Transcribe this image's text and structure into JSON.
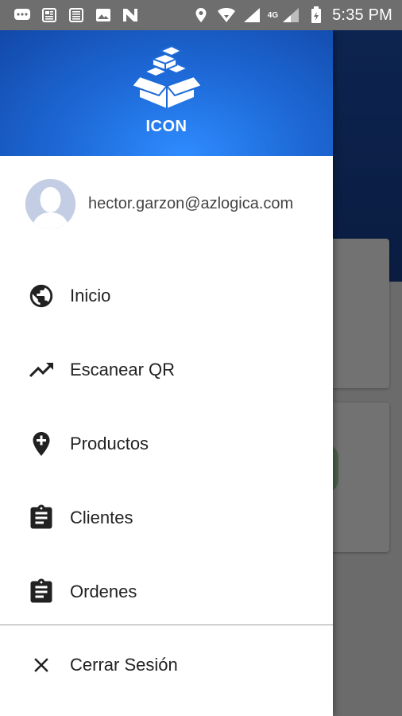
{
  "status_bar": {
    "network": "4G",
    "time": "5:35 PM",
    "left_icons": [
      "messages-icon",
      "news-icon",
      "news-icon",
      "image-icon",
      "n-app-icon"
    ],
    "right_icons": [
      "location-icon",
      "wifi-icon",
      "signal-icon",
      "signal-icon",
      "battery-icon"
    ]
  },
  "drawer": {
    "header": {
      "app_name": "ICON",
      "logo_icon": "boxes-logo-icon"
    },
    "profile": {
      "email": "hector.garzon@azlogica.com",
      "avatar_icon": "default-avatar-icon"
    },
    "menu": [
      {
        "label": "Inicio",
        "icon": "globe-icon"
      },
      {
        "label": "Escanear QR",
        "icon": "trending-up-icon"
      },
      {
        "label": "Productos",
        "icon": "add-location-icon"
      },
      {
        "label": "Clientes",
        "icon": "clipboard-icon"
      },
      {
        "label": "Ordenes",
        "icon": "clipboard-icon"
      }
    ],
    "logout": {
      "label": "Cerrar Sesión",
      "icon": "close-icon"
    }
  },
  "colors": {
    "header_gradient_start": "#2f8cff",
    "header_gradient_end": "#1248a8",
    "scrim": "#6b6b6b",
    "status_bar": "#6e6e6e"
  }
}
